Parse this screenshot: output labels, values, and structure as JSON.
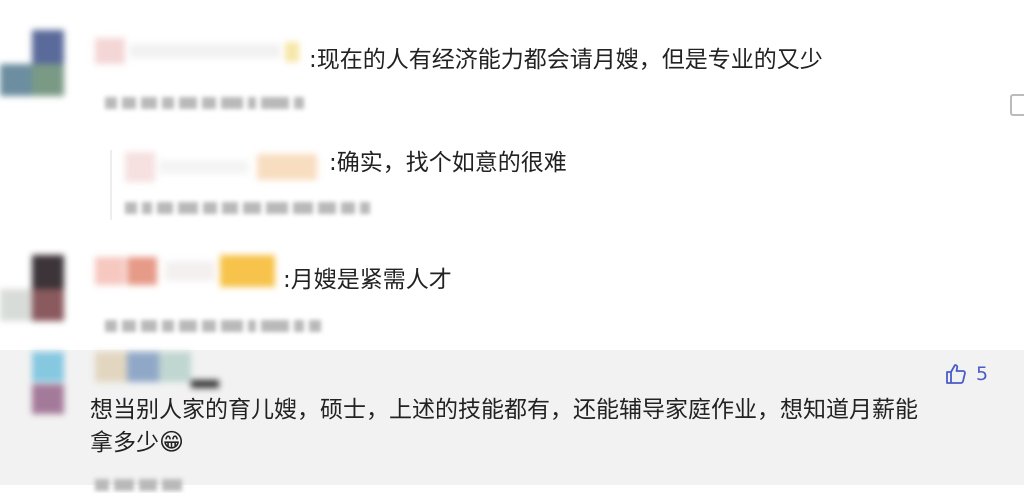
{
  "comments": [
    {
      "separator": ":",
      "text": "现在的人有经济能力都会请月嫂，但是专业的又少"
    },
    {
      "separator": ":",
      "text": "确实，找个如意的很难"
    },
    {
      "separator": ":",
      "text": "月嫂是紧需人才"
    }
  ],
  "featured": {
    "text_line1": "想当别人家的育儿嫂，硕士，上述的技能都有，还能辅导家庭作业，想知道月薪能",
    "text_line2": "拿多少",
    "emoji": "😁",
    "like_count": "5",
    "icons": {
      "like": "thumbs-up-icon",
      "emoji": "grin-emoji-icon"
    }
  }
}
